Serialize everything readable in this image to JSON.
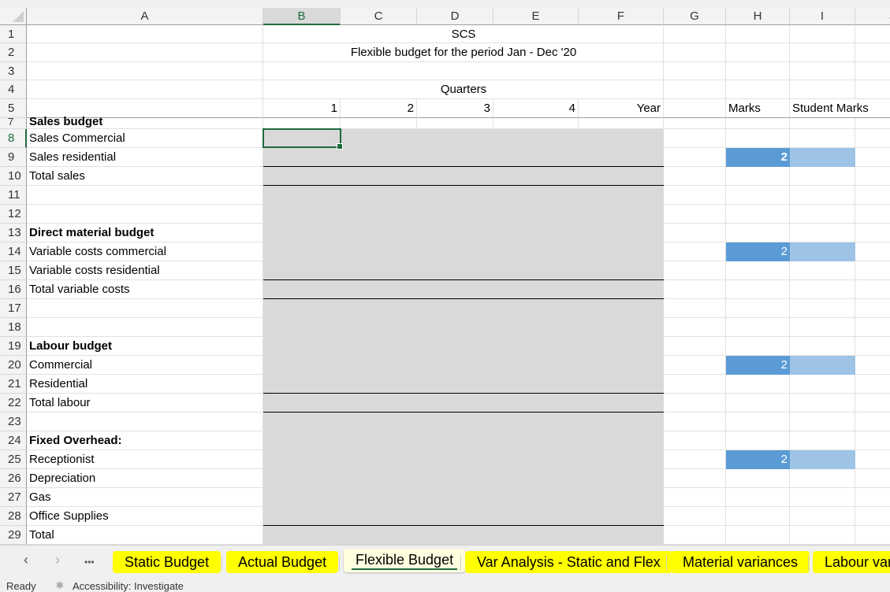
{
  "columns": [
    "A",
    "B",
    "C",
    "D",
    "E",
    "F",
    "G",
    "H",
    "I",
    "J"
  ],
  "selected_column": "B",
  "selected_row": "8",
  "title": "SCS",
  "subtitle": "Flexible budget  for the period Jan - Dec '20",
  "quarters_label": "Quarters",
  "quarter_headers": [
    "1",
    "2",
    "3",
    "4",
    "Year"
  ],
  "marks_header": "Marks",
  "student_marks_header": "Student Marks",
  "rows": [
    {
      "num": "1",
      "label": ""
    },
    {
      "num": "2",
      "label": ""
    },
    {
      "num": "3",
      "label": ""
    },
    {
      "num": "4",
      "label": ""
    },
    {
      "num": "5",
      "label": ""
    },
    {
      "num": "7",
      "label": "Sales budget",
      "bold": true
    },
    {
      "num": "8",
      "label": "Sales Commercial"
    },
    {
      "num": "9",
      "label": "Sales residential",
      "marks": "2",
      "marks_bold": true
    },
    {
      "num": "10",
      "label": "Total sales"
    },
    {
      "num": "11",
      "label": ""
    },
    {
      "num": "12",
      "label": ""
    },
    {
      "num": "13",
      "label": "Direct material budget",
      "bold": true
    },
    {
      "num": "14",
      "label": "Variable costs commercial",
      "marks": "2"
    },
    {
      "num": "15",
      "label": "Variable costs residential"
    },
    {
      "num": "16",
      "label": "Total variable costs"
    },
    {
      "num": "17",
      "label": ""
    },
    {
      "num": "18",
      "label": ""
    },
    {
      "num": "19",
      "label": "Labour budget",
      "bold": true
    },
    {
      "num": "20",
      "label": "Commercial",
      "marks": "2"
    },
    {
      "num": "21",
      "label": "Residential"
    },
    {
      "num": "22",
      "label": "Total labour"
    },
    {
      "num": "23",
      "label": ""
    },
    {
      "num": "24",
      "label": "Fixed Overhead:",
      "bold": true
    },
    {
      "num": "25",
      "label": "Receptionist",
      "marks": "2"
    },
    {
      "num": "26",
      "label": "Depreciation"
    },
    {
      "num": "27",
      "label": "Gas"
    },
    {
      "num": "28",
      "label": "Office Supplies"
    },
    {
      "num": "29",
      "label": "Total"
    }
  ],
  "colors": {
    "input_fill": "#d9d9d9",
    "marks_fill": "#5b9bd5",
    "student_marks_fill": "#9dc3e6",
    "accent": "#1e6b3d",
    "tab_fill": "#ffff00"
  },
  "sheet_tabs": [
    {
      "label": "Static Budget"
    },
    {
      "label": "Actual Budget"
    },
    {
      "label": "Flexible Budget",
      "active": true
    },
    {
      "label": "Var Analysis - Static and Flex"
    },
    {
      "label": "Material variances"
    },
    {
      "label": "Labour vari"
    }
  ],
  "nav": {
    "prev": "‹",
    "next": "›",
    "more": "•••"
  },
  "status": {
    "ready": "Ready",
    "accessibility": "Accessibility: Investigate"
  }
}
